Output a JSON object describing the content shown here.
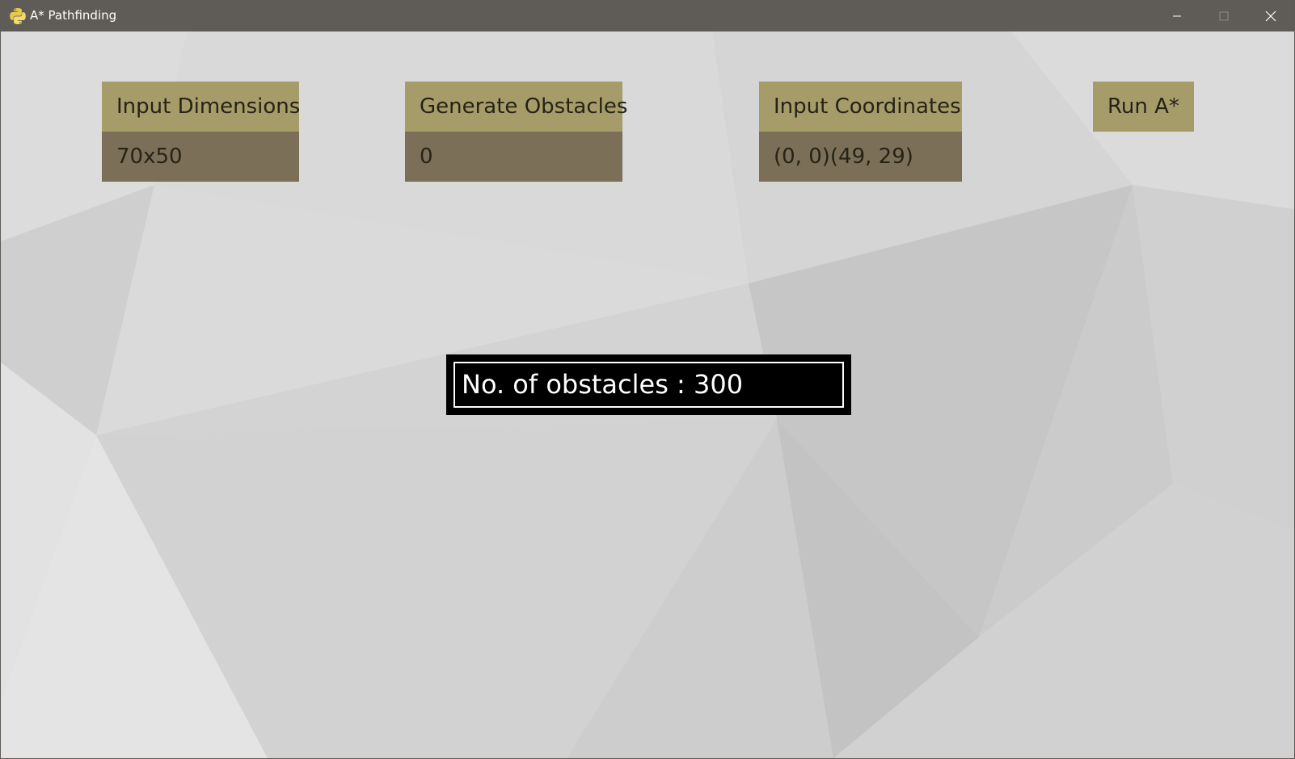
{
  "window": {
    "title": "A* Pathfinding",
    "app_icon": "python-icon",
    "controls": {
      "minimize_icon": "minimize-icon",
      "maximize_icon": "maximize-icon",
      "close_icon": "close-icon"
    }
  },
  "panels": {
    "dimensions": {
      "header": "Input Dimensions",
      "value": "70x50"
    },
    "obstacles": {
      "header": "Generate Obstacles",
      "value": "0"
    },
    "coordinates": {
      "header": "Input Coordinates",
      "value": "(0, 0)(49, 29)"
    },
    "run": {
      "header": "Run A*"
    }
  },
  "status": {
    "text": "No. of obstacles : 300"
  },
  "colors": {
    "titlebar": "#5f5b56",
    "panel_header": "#a69c6a",
    "panel_value": "#7b7057",
    "panel_text": "#262216",
    "status_bg": "#000000",
    "status_text": "#ffffff"
  }
}
